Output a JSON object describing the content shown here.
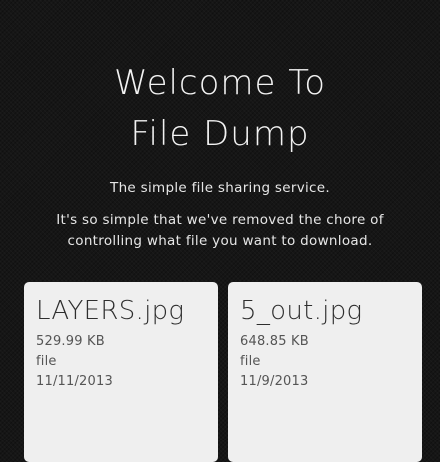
{
  "hero": {
    "title_line1": "Welcome To",
    "title_line2": "File Dump",
    "tagline": "The simple file sharing service.",
    "description": "It's so simple that we've removed the chore of controlling what file you want to download."
  },
  "files": [
    {
      "name": "LAYERS.jpg",
      "size": "529.99 KB",
      "type": "file",
      "date": "11/11/2013"
    },
    {
      "name": "5_out.jpg",
      "size": "648.85 KB",
      "type": "file",
      "date": "11/9/2013"
    }
  ],
  "colors": {
    "background": "#161616",
    "card_background": "#efefef",
    "title_text": "#f2f2f2"
  }
}
